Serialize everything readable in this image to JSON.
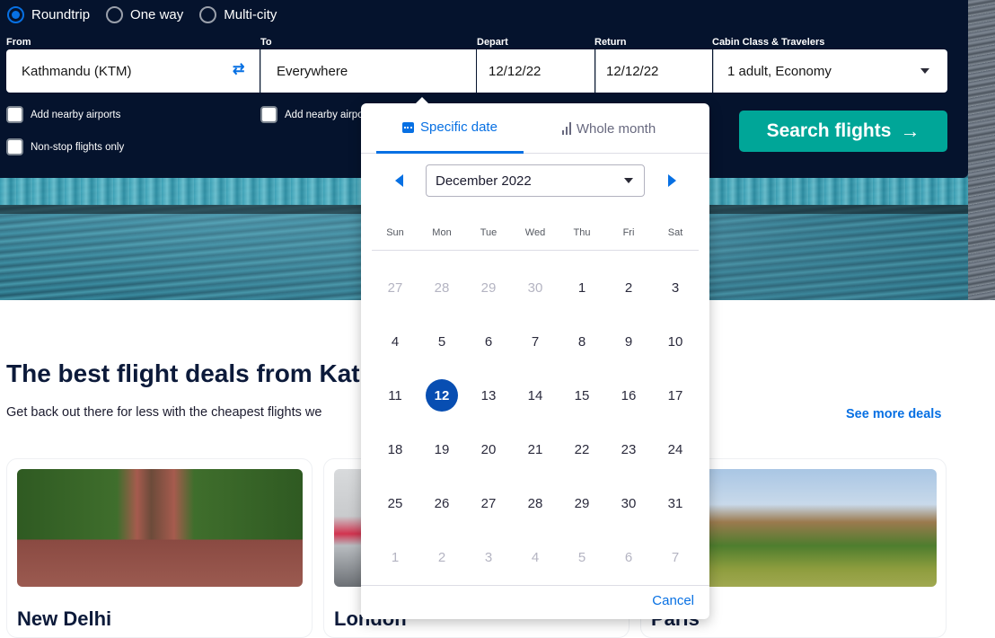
{
  "trip_types": [
    {
      "label": "Roundtrip",
      "checked": true
    },
    {
      "label": "One way",
      "checked": false
    },
    {
      "label": "Multi-city",
      "checked": false
    }
  ],
  "fields": {
    "from": {
      "label": "From",
      "value": "Kathmandu (KTM)"
    },
    "to": {
      "label": "To",
      "value": "Everywhere"
    },
    "depart": {
      "label": "Depart",
      "value": "12/12/22"
    },
    "return": {
      "label": "Return",
      "value": "12/12/22"
    },
    "cabin": {
      "label": "Cabin Class & Travelers",
      "value": "1 adult, Economy"
    }
  },
  "swap_icon": "⇄",
  "checkboxes": {
    "nearby_from": "Add nearby airports",
    "nearby_to": "Add nearby airports",
    "non_stop": "Non-stop flights only"
  },
  "search_button": {
    "label": "Search flights",
    "arrow": "→"
  },
  "deals": {
    "title": "The best flight deals from Kathmandu",
    "subtitle": "Get back out there for less with the cheapest flights we",
    "see_more": "See more deals",
    "cards": [
      {
        "city": "New Delhi"
      },
      {
        "city": "London"
      },
      {
        "city": "Paris"
      }
    ]
  },
  "date_picker": {
    "tabs": {
      "specific": "Specific date",
      "whole": "Whole month"
    },
    "month": "December 2022",
    "weekdays": [
      "Sun",
      "Mon",
      "Tue",
      "Wed",
      "Thu",
      "Fri",
      "Sat"
    ],
    "weeks": [
      [
        {
          "d": "27",
          "m": true
        },
        {
          "d": "28",
          "m": true
        },
        {
          "d": "29",
          "m": true
        },
        {
          "d": "30",
          "m": true
        },
        {
          "d": "1"
        },
        {
          "d": "2"
        },
        {
          "d": "3"
        }
      ],
      [
        {
          "d": "4"
        },
        {
          "d": "5"
        },
        {
          "d": "6"
        },
        {
          "d": "7"
        },
        {
          "d": "8"
        },
        {
          "d": "9"
        },
        {
          "d": "10"
        }
      ],
      [
        {
          "d": "11"
        },
        {
          "d": "12",
          "s": true
        },
        {
          "d": "13"
        },
        {
          "d": "14"
        },
        {
          "d": "15"
        },
        {
          "d": "16"
        },
        {
          "d": "17"
        }
      ],
      [
        {
          "d": "18"
        },
        {
          "d": "19"
        },
        {
          "d": "20"
        },
        {
          "d": "21"
        },
        {
          "d": "22"
        },
        {
          "d": "23"
        },
        {
          "d": "24"
        }
      ],
      [
        {
          "d": "25"
        },
        {
          "d": "26"
        },
        {
          "d": "27"
        },
        {
          "d": "28"
        },
        {
          "d": "29"
        },
        {
          "d": "30"
        },
        {
          "d": "31"
        }
      ],
      [
        {
          "d": "1",
          "m": true
        },
        {
          "d": "2",
          "m": true
        },
        {
          "d": "3",
          "m": true
        },
        {
          "d": "4",
          "m": true
        },
        {
          "d": "5",
          "m": true
        },
        {
          "d": "6",
          "m": true
        },
        {
          "d": "7",
          "m": true
        }
      ]
    ],
    "selected_date": "12",
    "cancel": "Cancel"
  }
}
